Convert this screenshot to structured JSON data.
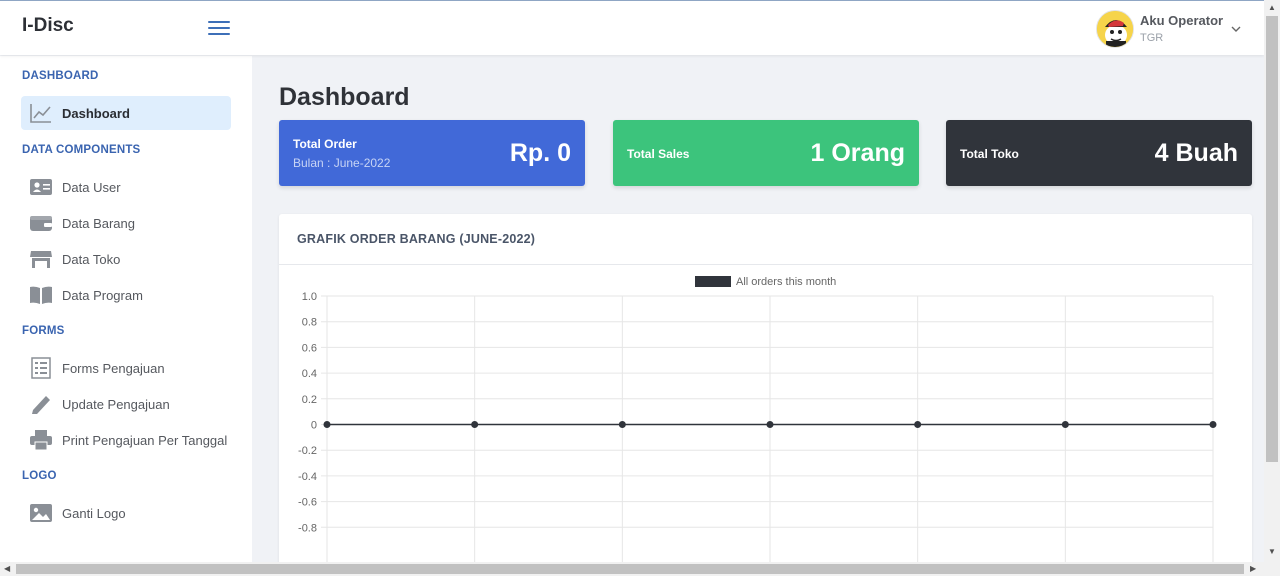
{
  "app": {
    "brand": "I-Disc"
  },
  "user": {
    "name": "Aku Operator",
    "role": "TGR"
  },
  "sidebar": {
    "sections": [
      {
        "label": "DASHBOARD"
      },
      {
        "label": "DATA COMPONENTS"
      },
      {
        "label": "FORMS"
      },
      {
        "label": "LOGO"
      }
    ],
    "items": [
      {
        "label": "Dashboard",
        "icon": "chart-line-icon"
      },
      {
        "label": "Data User",
        "icon": "id-card-icon"
      },
      {
        "label": "Data Barang",
        "icon": "wallet-icon"
      },
      {
        "label": "Data Toko",
        "icon": "store-icon"
      },
      {
        "label": "Data Program",
        "icon": "book-open-icon"
      },
      {
        "label": "Forms Pengajuan",
        "icon": "form-icon"
      },
      {
        "label": "Update Pengajuan",
        "icon": "pencil-icon"
      },
      {
        "label": "Print Pengajuan Per Tanggal",
        "icon": "printer-icon"
      },
      {
        "label": "Ganti Logo",
        "icon": "image-icon"
      }
    ]
  },
  "main": {
    "title": "Dashboard",
    "cards": [
      {
        "title": "Total Order",
        "subtitle": "Bulan : June-2022",
        "value": "Rp. 0",
        "color": "#4169d8"
      },
      {
        "title": "Total Sales",
        "value": "1 Orang",
        "color": "#3cc47c"
      },
      {
        "title": "Total Toko",
        "value": "4 Buah",
        "color": "#30343b"
      }
    ],
    "panel_title": "GRAFIK ORDER BARANG (JUNE-2022)"
  },
  "chart_data": {
    "type": "line",
    "series": [
      {
        "name": "All orders this month",
        "values": [
          0,
          0,
          0,
          0,
          0,
          0,
          0
        ],
        "color": "#30343b"
      }
    ],
    "yticks": [
      "1.0",
      "0.8",
      "0.6",
      "0.4",
      "0.2",
      "0",
      "-0.2",
      "-0.4",
      "-0.6",
      "-0.8"
    ],
    "ylim": [
      -1,
      1
    ],
    "grid": true,
    "legend": "top-center"
  }
}
